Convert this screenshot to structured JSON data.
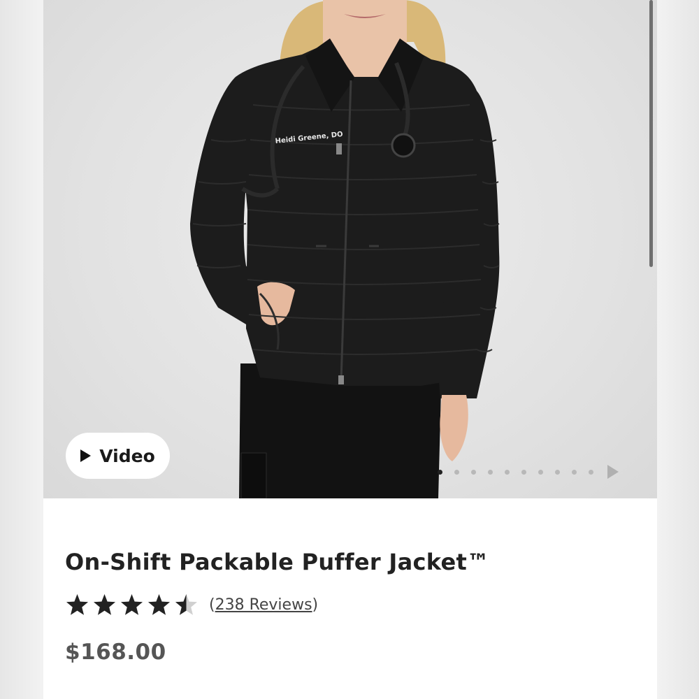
{
  "product": {
    "name": "On-Shift Packable Puffer Jacket™",
    "rating": 4.5,
    "rating_max": 5,
    "reviews_paren_open": "(",
    "reviews_label": "238 Reviews",
    "reviews_paren_close": ")",
    "price": "$168.00",
    "embroidery_text": "Heidi Greene, DO"
  },
  "gallery": {
    "video_label": "Video",
    "slide_count": 10,
    "active_slide": 1
  },
  "colors": {
    "jacket": "#1c1c1c",
    "star": "#222222",
    "star_empty": "#d0d0d0"
  }
}
